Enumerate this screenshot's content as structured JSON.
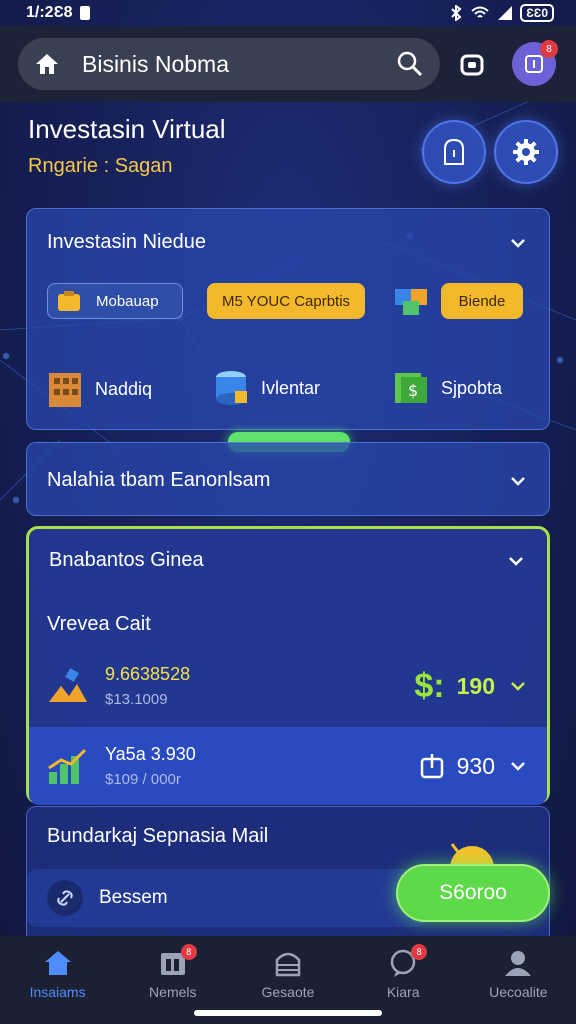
{
  "status_bar": {
    "time": "1/:2Ɛ8",
    "battery": "ƐƐ0"
  },
  "top_bar": {
    "title": "Bisinis Nobma",
    "avatar_badge": "8"
  },
  "header": {
    "title": "Investasin Virtual",
    "subtitle": "Rngarie : Sagan"
  },
  "panel_investasi": {
    "title": "Investasin Niedue",
    "chips": [
      "Mobauap",
      "M5 YOUC Caprbtis",
      "Biende"
    ],
    "tiles": [
      "Naddiq",
      "Ivlentar",
      "Sjpobta"
    ],
    "progress": 1.0
  },
  "panel_nalahia": {
    "title": "Nalahia tbam Eanonlsam"
  },
  "panel_bnabantos": {
    "title": "Bnabantos Ginea",
    "sublabel": "Vrevea Cait",
    "rows": [
      {
        "value": "9.6638528",
        "sub": "$13.1009",
        "currency": "$:",
        "amount": "190"
      },
      {
        "value": "Ya5a 3.930",
        "sub": "$109 / 000r",
        "amount": "930"
      }
    ]
  },
  "panel_bundarka": {
    "title": "Bundarkaj Sepnasia Mail",
    "row_label": "Bessem",
    "cta_label": "S6oroo"
  },
  "bottom_nav": [
    {
      "label": "Insaiams",
      "badge": ""
    },
    {
      "label": "Nemels",
      "badge": "8"
    },
    {
      "label": "Gesaote",
      "badge": ""
    },
    {
      "label": "Kiara",
      "badge": "8"
    },
    {
      "label": "Uecoalite",
      "badge": ""
    }
  ],
  "colors": {
    "accent_green": "#5ed94a",
    "accent_yellow": "#f4b82c",
    "active_nav": "#4f8cff"
  }
}
